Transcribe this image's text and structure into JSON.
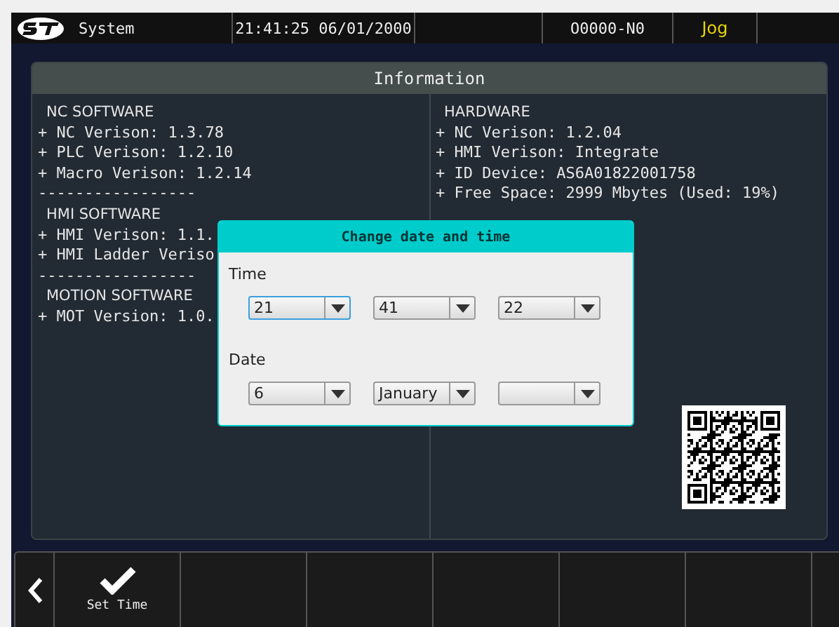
{
  "top_bar": {
    "section": "System",
    "clock": "21:41:25 06/01/2000",
    "program": "O0000-N0",
    "mode": "Jog"
  },
  "information": {
    "title": "Information",
    "left_lines": [
      {
        "kind": "heading",
        "text": "NC SOFTWARE"
      },
      {
        "kind": "item",
        "text": "+ NC Verison: 1.3.78"
      },
      {
        "kind": "item",
        "text": "+ PLC Verison: 1.2.10"
      },
      {
        "kind": "item",
        "text": "+ Macro Verison: 1.2.14"
      },
      {
        "kind": "rule",
        "text": "-----------------"
      },
      {
        "kind": "heading",
        "text": "HMI SOFTWARE"
      },
      {
        "kind": "item",
        "text": "+ HMI Verison: 1.1."
      },
      {
        "kind": "item",
        "text": "+ HMI Ladder Veriso"
      },
      {
        "kind": "rule",
        "text": "-----------------"
      },
      {
        "kind": "heading",
        "text": "MOTION SOFTWARE"
      },
      {
        "kind": "item",
        "text": "+ MOT Version: 1.0."
      }
    ],
    "right_lines": [
      {
        "kind": "heading",
        "text": "HARDWARE"
      },
      {
        "kind": "item",
        "text": "+ NC Verison: 1.2.04"
      },
      {
        "kind": "item",
        "text": "+ HMI Verison: Integrate"
      },
      {
        "kind": "item",
        "text": "+ ID Device: AS6A01822001758"
      },
      {
        "kind": "item",
        "text": "+ Free Space: 2999 Mbytes (Used: 19%)"
      }
    ]
  },
  "dialog": {
    "title": "Change date and time",
    "groups": [
      {
        "label": "Time",
        "fields": [
          {
            "value": "21",
            "focused": true
          },
          {
            "value": "41",
            "focused": false
          },
          {
            "value": "22",
            "focused": false
          }
        ]
      },
      {
        "label": "Date",
        "fields": [
          {
            "value": "6",
            "focused": false
          },
          {
            "value": "January",
            "focused": false
          },
          {
            "focused": false
          }
        ]
      }
    ]
  },
  "softkeys": [
    {
      "kind": "back"
    },
    {
      "kind": "check",
      "label": "Set Time"
    },
    {
      "kind": "empty"
    },
    {
      "kind": "empty"
    },
    {
      "kind": "empty"
    },
    {
      "kind": "empty"
    },
    {
      "kind": "empty"
    },
    {
      "kind": "empty"
    }
  ]
}
